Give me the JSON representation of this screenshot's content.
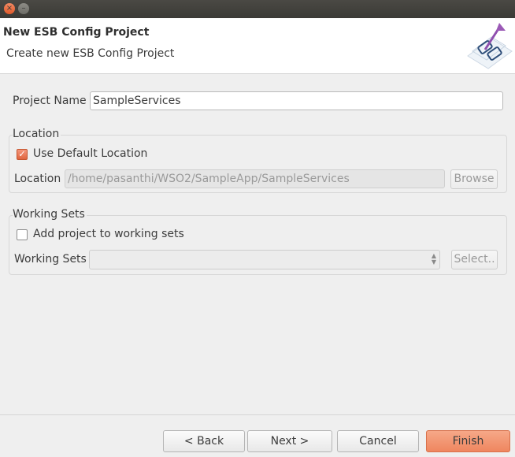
{
  "window": {
    "title_buttons": [
      "close-icon",
      "minimize-icon"
    ],
    "close_glyph": "×",
    "minimize_glyph": "–"
  },
  "header": {
    "title": "New ESB Config Project",
    "subtitle": "Create new ESB Config Project",
    "logo_icon": "wizard-banner-icon"
  },
  "form": {
    "project_name_label": "Project Name",
    "project_name_value": "SampleServices",
    "location_group": {
      "title": "Location",
      "use_default_label": "Use Default Location",
      "use_default_checked": true,
      "check_glyph": "✓",
      "location_label": "Location",
      "location_value": "/home/pasanthi/WSO2/SampleApp/SampleServices",
      "browse_label": "Browse"
    },
    "working_sets_group": {
      "title": "Working Sets",
      "add_label": "Add project to working sets",
      "add_checked": false,
      "working_sets_label": "Working Sets",
      "working_sets_value": "",
      "select_label": "Select.."
    }
  },
  "footer": {
    "back_label": "< Back",
    "next_label": "Next >",
    "cancel_label": "Cancel",
    "finish_label": "Finish"
  },
  "colors": {
    "accent": "#ef865f",
    "titlebar": "#3b3a36",
    "header_bg": "#ffffff",
    "body_bg": "#efefef"
  }
}
